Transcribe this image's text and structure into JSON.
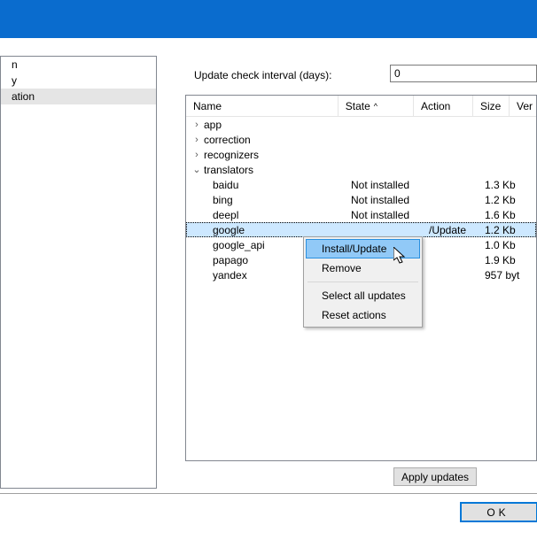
{
  "sidebar": {
    "items": [
      {
        "label": "n"
      },
      {
        "label": "y"
      },
      {
        "label": "ation"
      }
    ],
    "selected_index": 2
  },
  "interval": {
    "label": "Update check interval (days):",
    "value": "0"
  },
  "table": {
    "headers": {
      "name": "Name",
      "state": "State",
      "action": "Action",
      "size": "Size",
      "ver": "Ver"
    },
    "sort_col": "state",
    "sort_dir": "asc",
    "nodes": [
      {
        "type": "folder",
        "expanded": false,
        "label": "app"
      },
      {
        "type": "folder",
        "expanded": false,
        "label": "correction"
      },
      {
        "type": "folder",
        "expanded": false,
        "label": "recognizers"
      },
      {
        "type": "folder",
        "expanded": true,
        "label": "translators",
        "children": [
          {
            "label": "baidu",
            "state": "Not installed",
            "action": "",
            "size": "1.3 Kb"
          },
          {
            "label": "bing",
            "state": "Not installed",
            "action": "",
            "size": "1.2 Kb"
          },
          {
            "label": "deepl",
            "state": "Not installed",
            "action": "",
            "size": "1.6 Kb"
          },
          {
            "label": "google",
            "state": "",
            "action": "/Update",
            "size": "1.2 Kb",
            "selected": true
          },
          {
            "label": "google_api",
            "state": "",
            "action": "",
            "size": "1.0 Kb"
          },
          {
            "label": "papago",
            "state": "",
            "action": "",
            "size": "1.9 Kb"
          },
          {
            "label": "yandex",
            "state": "",
            "action": "",
            "size": "957 byt..."
          }
        ]
      }
    ]
  },
  "context_menu": {
    "items": [
      {
        "label": "Install/Update",
        "hover": true
      },
      {
        "label": "Remove"
      },
      {
        "sep": true
      },
      {
        "label": "Select all updates"
      },
      {
        "label": "Reset actions"
      }
    ]
  },
  "buttons": {
    "apply": "Apply updates",
    "ok": "OK"
  }
}
